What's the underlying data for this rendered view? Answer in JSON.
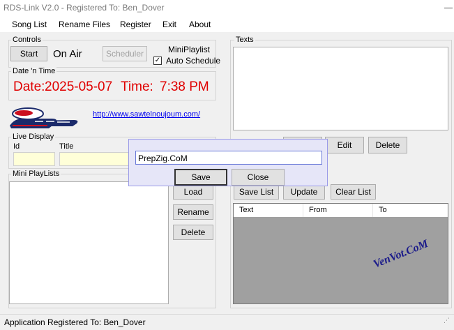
{
  "window": {
    "title": "RDS-Link V2.0 - Registered To: Ben_Dover"
  },
  "menu": [
    "Song List",
    "Rename Files",
    "Register",
    "Exit",
    "About"
  ],
  "controls": {
    "label": "Controls",
    "start_label": "Start",
    "status": "On Air",
    "scheduler_label": "Scheduler",
    "miniplaylist_label": "MiniPlaylist",
    "auto_schedule_label": "Auto Schedule",
    "auto_schedule_checked": true
  },
  "datetime": {
    "label": "Date 'n Time",
    "date_prefix": "Date:",
    "date_value": "2025-05-07",
    "time_prefix": "Time:",
    "time_value": "7:38 PM"
  },
  "website": {
    "url": "http://www.sawtelnoujoum.com/"
  },
  "live_display": {
    "label": "Live Display",
    "id_label": "Id",
    "title_label": "Title"
  },
  "mini_playlists": {
    "label": "Mini PlayLists",
    "load_label": "Load",
    "rename_label": "Rename",
    "delete_label": "Delete"
  },
  "texts": {
    "label": "Texts",
    "edit_label": "Edit",
    "delete_label": "Delete",
    "save_list_label": "Save List",
    "update_label": "Update",
    "clear_list_label": "Clear List",
    "columns": [
      "Text",
      "From",
      "To"
    ]
  },
  "dialog": {
    "input_value": "PrepZig.CoM",
    "save_label": "Save",
    "close_label": "Close"
  },
  "watermark": "VenVot.CoM",
  "statusbar": {
    "text": "Application Registered To: Ben_Dover"
  },
  "colors": {
    "accent_red": "#e00000",
    "dialog_bg": "#e6e6f8",
    "dialog_border": "#9a9ae8"
  }
}
